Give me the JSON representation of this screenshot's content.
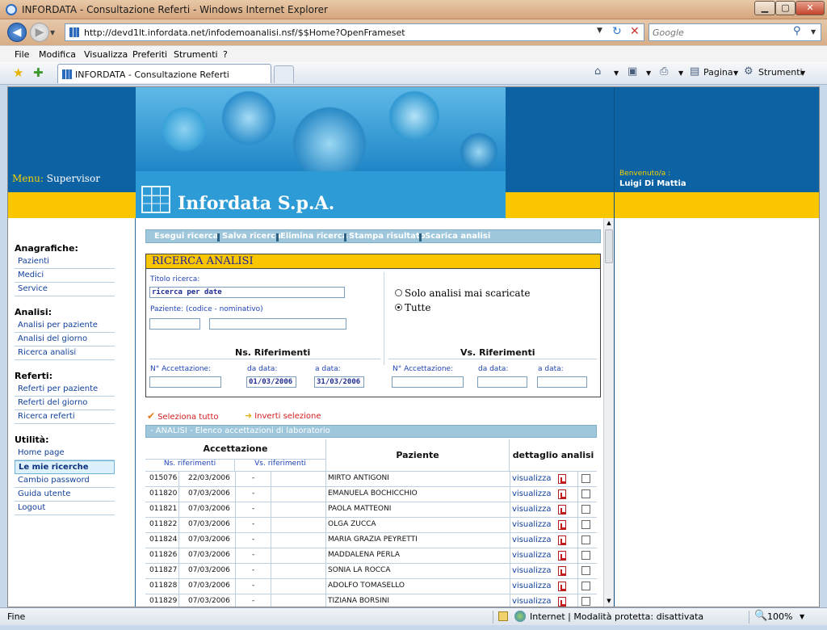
{
  "window": {
    "title": "INFORDATA - Consultazione Referti - Windows Internet Explorer",
    "min_label": "▁",
    "max_label": "▢",
    "close_label": "✕"
  },
  "nav": {
    "url": "http://devd1lt.infordata.net/infodemoanalisi.nsf/$$Home?OpenFrameset",
    "search_placeholder": "Google",
    "back_label": "◀",
    "forward_label": "▶"
  },
  "menubar": [
    "File",
    "Modifica",
    "Visualizza",
    "Preferiti",
    "Strumenti",
    "?"
  ],
  "tab": {
    "title": "INFORDATA - Consultazione Referti"
  },
  "commandbar": {
    "page_label": "Pagina",
    "tools_label": "Strumenti"
  },
  "header": {
    "menu_label": "Menu:",
    "menu_user": "Supervisor",
    "brand": "Infordata S.p.A.",
    "welcome_label": "Benvenuto/a :",
    "welcome_name": "Luigi Di Mattia"
  },
  "sidebar": {
    "sections": [
      {
        "title": "Anagrafiche:",
        "items": [
          "Pazienti",
          "Medici",
          "Service"
        ]
      },
      {
        "title": "Analisi:",
        "items": [
          "Analisi per paziente",
          "Analisi del giorno",
          "Ricerca analisi"
        ]
      },
      {
        "title": "Referti:",
        "items": [
          "Referti per paziente",
          "Referti del giorno",
          "Ricerca referti"
        ]
      },
      {
        "title": "Utilità:",
        "items": [
          "Home page",
          "Le mie ricerche",
          "Cambio password",
          "Guida utente",
          "Logout"
        ]
      }
    ],
    "active_item": "Le mie ricerche"
  },
  "toolbar": {
    "actions": [
      "Esegui ricerca",
      "Salva ricerca",
      "Elimina ricerca",
      "Stampa risultato",
      "Scarica analisi"
    ]
  },
  "search_panel": {
    "title": "RICERCA ANALISI",
    "titolo_label": "Titolo ricerca:",
    "titolo_value": "ricerca per date",
    "paziente_label": "Paziente:  (codice  -  nominativo)",
    "paziente_code": "",
    "paziente_name": "",
    "radio_options": [
      "Solo analisi mai scaricate",
      "Tutte"
    ],
    "radio_selected": "Tutte",
    "ns_heading": "Ns. Riferimenti",
    "vs_heading": "Vs. Riferimenti",
    "ns": {
      "acc_label": "N° Accettazione:",
      "acc_value": "",
      "from_label": "da data:",
      "from_value": "01/03/2006",
      "to_label": "a data:",
      "to_value": "31/03/2006"
    },
    "vs": {
      "acc_label": "N° Accettazione:",
      "acc_value": "",
      "from_label": "da data:",
      "from_value": "",
      "to_label": "a data:",
      "to_value": ""
    }
  },
  "selection": {
    "select_all": "Seleziona tutto",
    "invert": "Inverti selezione"
  },
  "results": {
    "heading": "- ANALISI - Elenco accettazioni di laboratorio",
    "col_accettazione": "Accettazione",
    "col_ns": "Ns. riferimenti",
    "col_vs": "Vs. riferimenti",
    "col_paziente": "Paziente",
    "col_dettaglio": "dettaglio analisi",
    "link_label": "visualizza",
    "rows": [
      {
        "ns": "015076",
        "date": "22/03/2006",
        "vs": "-",
        "patient": "MIRTO ANTIGONI"
      },
      {
        "ns": "011820",
        "date": "07/03/2006",
        "vs": "-",
        "patient": "EMANUELA BOCHICCHIO"
      },
      {
        "ns": "011821",
        "date": "07/03/2006",
        "vs": "-",
        "patient": "PAOLA MATTEONI"
      },
      {
        "ns": "011822",
        "date": "07/03/2006",
        "vs": "-",
        "patient": "OLGA ZUCCA"
      },
      {
        "ns": "011824",
        "date": "07/03/2006",
        "vs": "-",
        "patient": "MARIA GRAZIA PEYRETTI"
      },
      {
        "ns": "011826",
        "date": "07/03/2006",
        "vs": "-",
        "patient": "MADDALENA PERLA"
      },
      {
        "ns": "011827",
        "date": "07/03/2006",
        "vs": "-",
        "patient": "SONIA LA ROCCA"
      },
      {
        "ns": "011828",
        "date": "07/03/2006",
        "vs": "-",
        "patient": "ADOLFO TOMASELLO"
      },
      {
        "ns": "011829",
        "date": "07/03/2006",
        "vs": "-",
        "patient": "TIZIANA BORSINI"
      }
    ]
  },
  "statusbar": {
    "left": "Fine",
    "zone": "Internet | Modalità protetta: disattivata",
    "zoom": "100%"
  }
}
